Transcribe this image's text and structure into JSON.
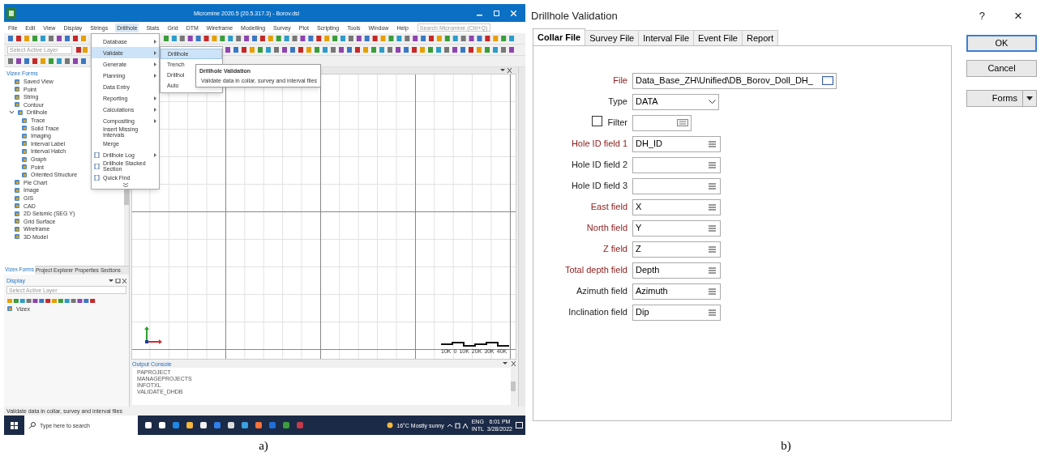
{
  "app": {
    "title": "Micromine 2020.5 (20.5.317.3) - Borov.dsl",
    "menus": [
      {
        "label": "File",
        "selected": false
      },
      {
        "label": "Edit",
        "selected": false
      },
      {
        "label": "View",
        "selected": false
      },
      {
        "label": "Display",
        "selected": false
      },
      {
        "label": "Strings",
        "selected": false
      },
      {
        "label": "Drillhole",
        "selected": true
      },
      {
        "label": "Stats",
        "selected": false
      },
      {
        "label": "Grid",
        "selected": false
      },
      {
        "label": "DTM",
        "selected": false
      },
      {
        "label": "Wireframe",
        "selected": false
      },
      {
        "label": "Modelling",
        "selected": false
      },
      {
        "label": "Survey",
        "selected": false
      },
      {
        "label": "Plot",
        "selected": false
      },
      {
        "label": "Scripting",
        "selected": false
      },
      {
        "label": "Tools",
        "selected": false
      },
      {
        "label": "Window",
        "selected": false
      },
      {
        "label": "Help",
        "selected": false
      }
    ],
    "search": {
      "placeholder": "Search Micromine (Ctrl+Q)"
    },
    "layer_select": {
      "placeholder": "Select Active Layer"
    }
  },
  "drillhole_menu": {
    "items": [
      {
        "label": "Database",
        "submenu": true,
        "selected": false,
        "has_icon": false
      },
      {
        "label": "Validate",
        "submenu": true,
        "selected": true,
        "has_icon": false
      },
      {
        "label": "Generate",
        "submenu": true,
        "selected": false,
        "has_icon": false
      },
      {
        "label": "Planning",
        "submenu": true,
        "selected": false,
        "has_icon": false
      },
      {
        "label": "Data Entry",
        "submenu": false,
        "selected": false,
        "has_icon": false
      },
      {
        "label": "Reporting",
        "submenu": true,
        "selected": false,
        "has_icon": false
      },
      {
        "label": "Calculations",
        "submenu": true,
        "selected": false,
        "has_icon": false
      },
      {
        "label": "Compositing",
        "submenu": true,
        "selected": false,
        "has_icon": false
      },
      {
        "label": "Insert Missing Intervals",
        "submenu": false,
        "selected": false,
        "has_icon": false
      },
      {
        "label": "Merge",
        "submenu": false,
        "selected": false,
        "has_icon": false
      },
      {
        "label": "Drillhole Log",
        "submenu": true,
        "selected": false,
        "has_icon": true
      },
      {
        "label": "Drillhole Stacked Section",
        "submenu": false,
        "selected": false,
        "has_icon": true
      },
      {
        "label": "Quick Find",
        "submenu": false,
        "selected": false,
        "has_icon": true
      }
    ]
  },
  "validate_submenu": {
    "items": [
      {
        "label": "Drillhole",
        "selected": true
      },
      {
        "label": "Trench",
        "selected": false
      },
      {
        "label": "Drillhol",
        "selected": false
      },
      {
        "label": "Auto",
        "selected": false
      }
    ]
  },
  "tooltip": {
    "title": "Drillhole Validation",
    "text": "Validate data in collar, survey and interval files"
  },
  "vizex_forms": {
    "title": "Vizex Forms",
    "items": [
      {
        "label": "Saved View"
      },
      {
        "label": "Point"
      },
      {
        "label": "String"
      },
      {
        "label": "Contour"
      },
      {
        "label": "Drillhole",
        "expanded": true,
        "children": [
          {
            "label": "Trace"
          },
          {
            "label": "Solid Trace"
          },
          {
            "label": "Imaging"
          },
          {
            "label": "Interval Label"
          },
          {
            "label": "Interval Hatch"
          },
          {
            "label": "Graph"
          },
          {
            "label": "Point"
          },
          {
            "label": "Oriented Structure"
          }
        ]
      },
      {
        "label": "Pie Chart"
      },
      {
        "label": "Image"
      },
      {
        "label": "GIS"
      },
      {
        "label": "CAD"
      },
      {
        "label": "2D Seismic (SEG Y)"
      },
      {
        "label": "Grid Surface"
      },
      {
        "label": "Wireframe"
      },
      {
        "label": "3D Model"
      }
    ]
  },
  "panel_tabs": [
    {
      "label": "Vizex Forms",
      "selected": true
    },
    {
      "label": "Project Explorer",
      "selected": false
    },
    {
      "label": "Properties",
      "selected": false
    },
    {
      "label": "Sections",
      "selected": false
    }
  ],
  "display_panel": {
    "title": "Display",
    "layer_select": {
      "placeholder": "Select Active Layer"
    },
    "layers": [
      "Vizex"
    ]
  },
  "viewport": {
    "scale_labels": [
      "10K",
      "0",
      "10K",
      "20K",
      "30K",
      "40K"
    ]
  },
  "output_console": {
    "title": "Output Console",
    "lines": [
      "PAPROJECT",
      "MANAGEPROJECTS",
      "INFOTXL",
      "VALIDATE_DHDB"
    ]
  },
  "status_bar": {
    "text": "Validate data in collar, survey and interval files"
  },
  "taskbar": {
    "search_placeholder": "Type here to search",
    "weather": "16°C  Mostly sunny",
    "language": "ENG",
    "region": "INTL",
    "time": "6:01 PM",
    "date": "3/28/2022"
  },
  "dialog": {
    "title": "Drillhole Validation",
    "help": "?",
    "close": "×",
    "tabs": [
      {
        "label": "Collar File",
        "selected": true
      },
      {
        "label": "Survey File",
        "selected": false
      },
      {
        "label": "Interval File",
        "selected": false
      },
      {
        "label": "Event File",
        "selected": false
      },
      {
        "label": "Report",
        "selected": false
      }
    ],
    "fields": [
      {
        "kind": "file",
        "label": "File",
        "required": true,
        "value": "Data_Base_ZH\\Unified\\DB_Borov_Doll_DH_"
      },
      {
        "kind": "dropdown",
        "label": "Type",
        "required": false,
        "value": "DATA"
      },
      {
        "kind": "filter",
        "label": "Filter",
        "checked": false
      },
      {
        "kind": "list",
        "label": "Hole ID field 1",
        "required": true,
        "value": "DH_ID"
      },
      {
        "kind": "list",
        "label": "Hole ID field 2",
        "required": false
      },
      {
        "kind": "list",
        "label": "Hole ID field 3",
        "required": false
      },
      {
        "kind": "list",
        "label": "East field",
        "required": true,
        "value": "X"
      },
      {
        "kind": "list",
        "label": "North field",
        "required": true,
        "value": "Y"
      },
      {
        "kind": "list",
        "label": "Z field",
        "required": true,
        "value": "Z"
      },
      {
        "kind": "list",
        "label": "Total depth field",
        "required": true,
        "value": "Depth"
      },
      {
        "kind": "list",
        "label": "Azimuth field",
        "required": false,
        "value": "Azimuth"
      },
      {
        "kind": "list",
        "label": "Inclination field",
        "required": false,
        "value": "Dip"
      }
    ],
    "buttons": [
      {
        "label": "OK",
        "default": true,
        "dropdown": false
      },
      {
        "label": "Cancel",
        "default": false,
        "dropdown": false
      },
      {
        "label": "Forms",
        "default": false,
        "dropdown": true
      }
    ]
  },
  "captions": [
    "a)",
    "b)"
  ]
}
